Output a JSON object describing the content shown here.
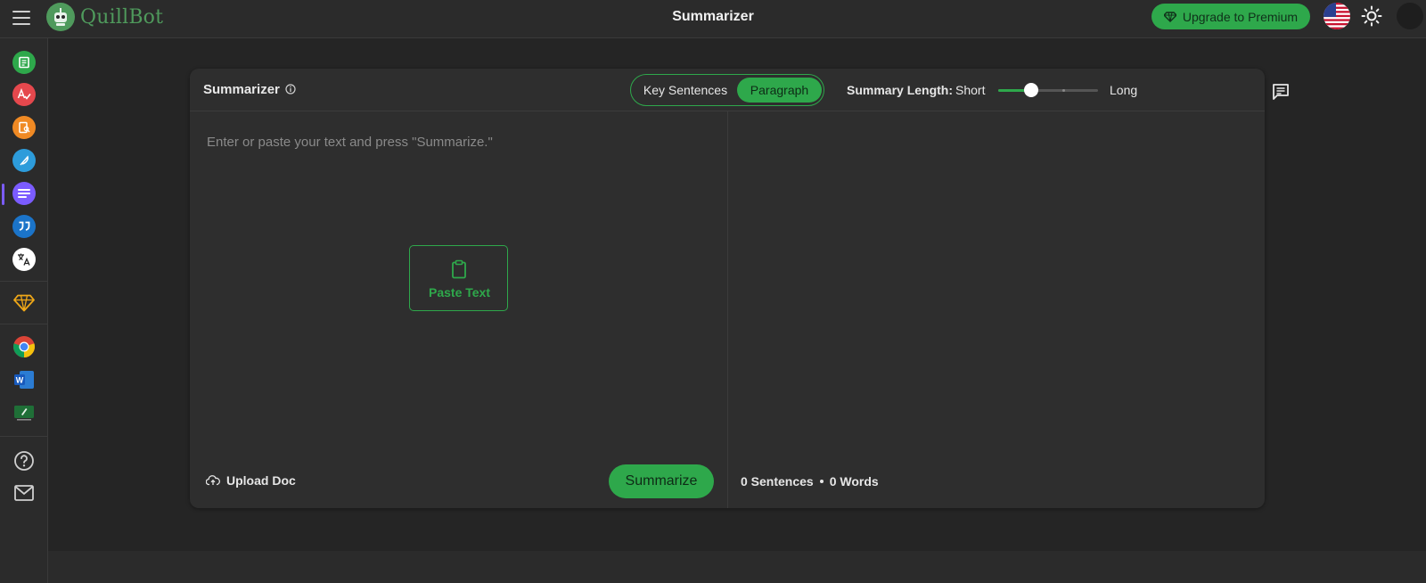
{
  "header": {
    "app_name": "QuillBot",
    "page_title": "Summarizer",
    "upgrade_label": "Upgrade to Premium",
    "accent_color": "#2ea84b"
  },
  "sidebar": {
    "items": [
      {
        "name": "paraphraser",
        "icon": "document-icon",
        "color": "#2ea84b"
      },
      {
        "name": "grammar-checker",
        "icon": "grammar-check-icon",
        "color": "#e5484d"
      },
      {
        "name": "plagiarism-checker",
        "icon": "plagiarism-icon",
        "color": "#f08a24"
      },
      {
        "name": "co-writer",
        "icon": "feather-icon",
        "color": "#2d9cdb"
      },
      {
        "name": "summarizer",
        "icon": "summarizer-lines-icon",
        "color": "#7b5cff",
        "active": true
      },
      {
        "name": "citation-generator",
        "icon": "quote-icon",
        "color": "#1b74c9"
      },
      {
        "name": "translator",
        "icon": "translate-icon",
        "color": "#ffffff"
      },
      {
        "name": "premium",
        "icon": "diamond-icon",
        "color": "#f0a818"
      },
      {
        "name": "chrome-extension",
        "icon": "chrome-icon"
      },
      {
        "name": "word-addin",
        "icon": "word-icon"
      },
      {
        "name": "mac-app",
        "icon": "desktop-app-icon"
      },
      {
        "name": "help",
        "icon": "help-circle-icon"
      },
      {
        "name": "contact",
        "icon": "mail-icon"
      }
    ]
  },
  "card": {
    "title": "Summarizer",
    "modes": {
      "key_sentences": "Key Sentences",
      "paragraph": "Paragraph",
      "selected": "Paragraph"
    },
    "summary_length_label": "Summary Length:",
    "short_label": "Short",
    "long_label": "Long",
    "summary_length_value": 0.33,
    "input_placeholder": "Enter or paste your text and press \"Summarize.\"",
    "paste_label": "Paste Text",
    "upload_label": "Upload Doc",
    "summarize_label": "Summarize",
    "sentences_count": "0 Sentences",
    "words_count": "0 Words"
  }
}
